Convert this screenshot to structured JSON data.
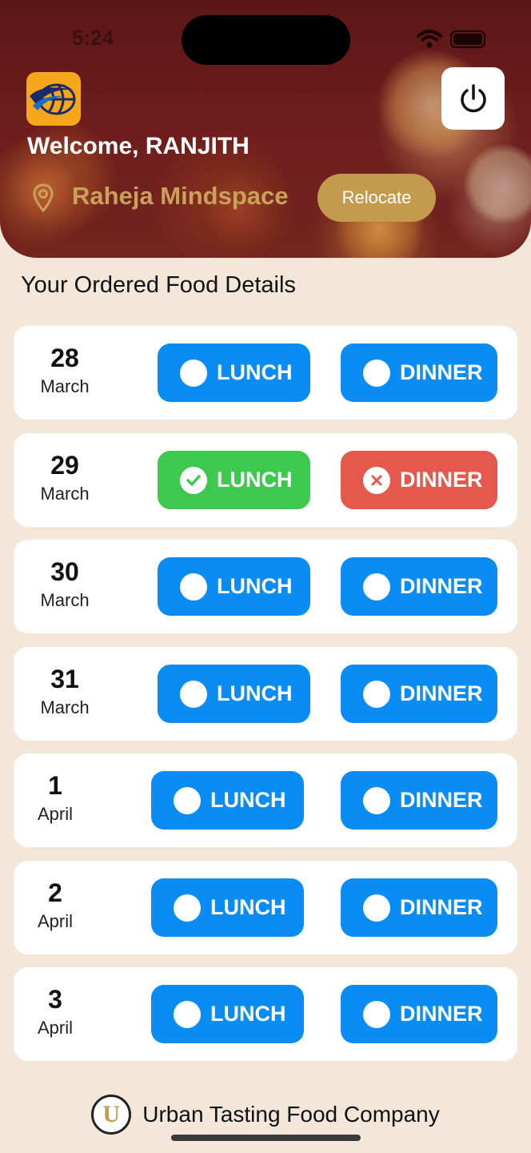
{
  "status_bar": {
    "time": "5:24"
  },
  "header": {
    "welcome": "Welcome, RANJITH",
    "location": "Raheja Mindspace",
    "relocate_label": "Relocate"
  },
  "section_title": "Your Ordered Food Details",
  "meal_labels": {
    "lunch": "LUNCH",
    "dinner": "DINNER"
  },
  "days": [
    {
      "day": "28",
      "month": "March",
      "lunch": "unselected",
      "dinner": "unselected"
    },
    {
      "day": "29",
      "month": "March",
      "lunch": "confirmed",
      "dinner": "cancelled"
    },
    {
      "day": "30",
      "month": "March",
      "lunch": "unselected",
      "dinner": "unselected"
    },
    {
      "day": "31",
      "month": "March",
      "lunch": "unselected",
      "dinner": "unselected"
    },
    {
      "day": "1",
      "month": "April",
      "lunch": "unselected",
      "dinner": "unselected"
    },
    {
      "day": "2",
      "month": "April",
      "lunch": "unselected",
      "dinner": "unselected"
    },
    {
      "day": "3",
      "month": "April",
      "lunch": "unselected",
      "dinner": "unselected"
    }
  ],
  "footer": {
    "company": "Urban Tasting Food Company",
    "logo_letter": "U"
  },
  "colors": {
    "accent_blue": "#0a8cf5",
    "confirmed_green": "#3dc84e",
    "cancelled_red": "#e4594b",
    "gold": "#c49a4e",
    "background": "#f2e7d9"
  },
  "icons": {
    "app_logo": "globe-logo-icon",
    "power": "power-icon",
    "location": "location-pin-icon",
    "confirmed": "check-circle-icon",
    "cancelled": "x-circle-icon",
    "unselected": "empty-circle-icon"
  }
}
